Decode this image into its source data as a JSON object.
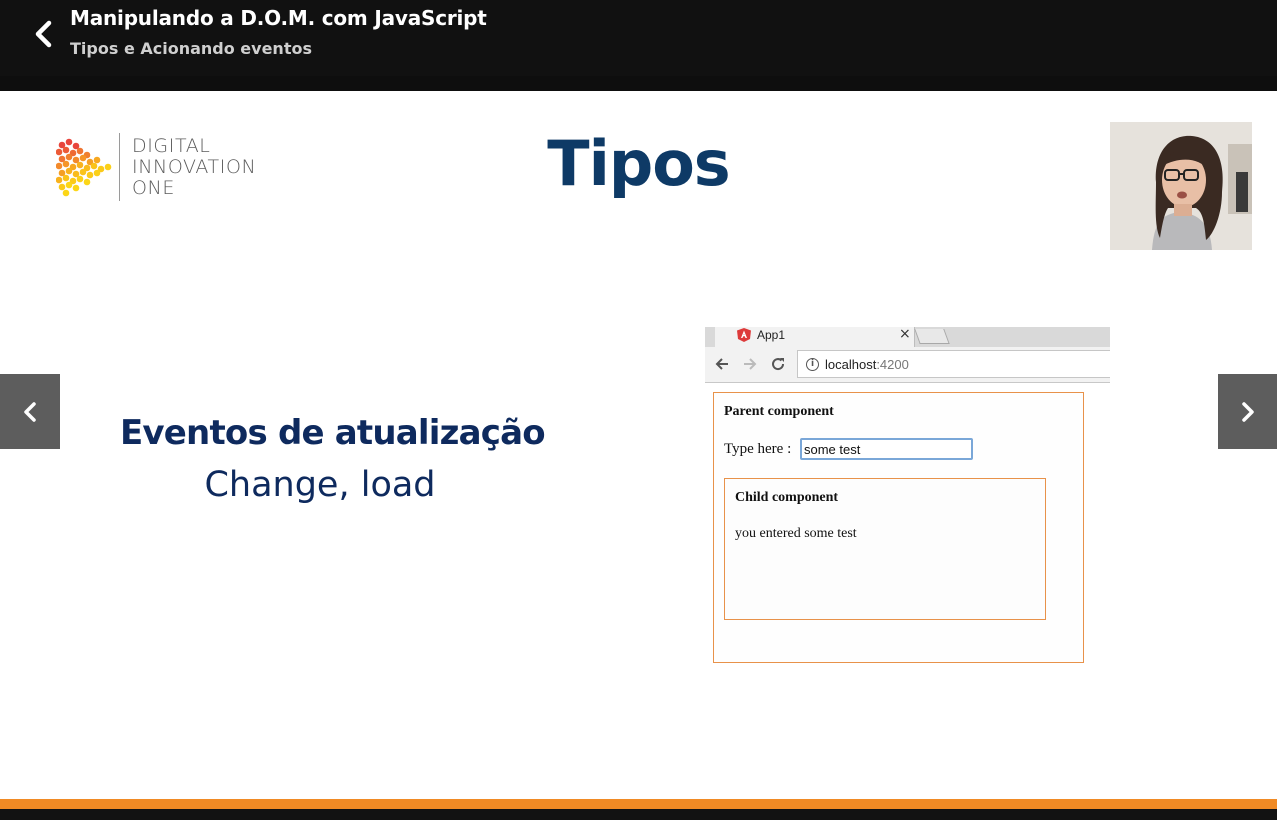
{
  "header": {
    "title": "Manipulando a D.O.M. com JavaScript",
    "subtitle": "Tipos e Acionando eventos"
  },
  "slide": {
    "logo": {
      "line1": "DIGITAL",
      "line2": "INNOVATION",
      "line3": "ONE"
    },
    "heading": "Tipos",
    "event_title": "Eventos de atualização",
    "event_subtitle": "Change, load"
  },
  "embedded_browser": {
    "tab_label": "App1",
    "tab_close": "×",
    "url_host": "localhost",
    "url_port": ":4200",
    "parent_title": "Parent component",
    "input_label": "Type here :",
    "input_value": "some test",
    "child_title": "Child component",
    "child_text": "you entered some test"
  },
  "icons": {
    "back": "chevron-left-icon",
    "prev": "chevron-left-icon",
    "next": "chevron-right-icon"
  },
  "colors": {
    "header_bg": "#111111",
    "slide_bg": "#ffffff",
    "heading": "#0e3a66",
    "text_dark_blue": "#0e2a5e",
    "accent_orange": "#f08a24",
    "side_button": "#5d5d5d",
    "component_border": "#e8924a"
  }
}
